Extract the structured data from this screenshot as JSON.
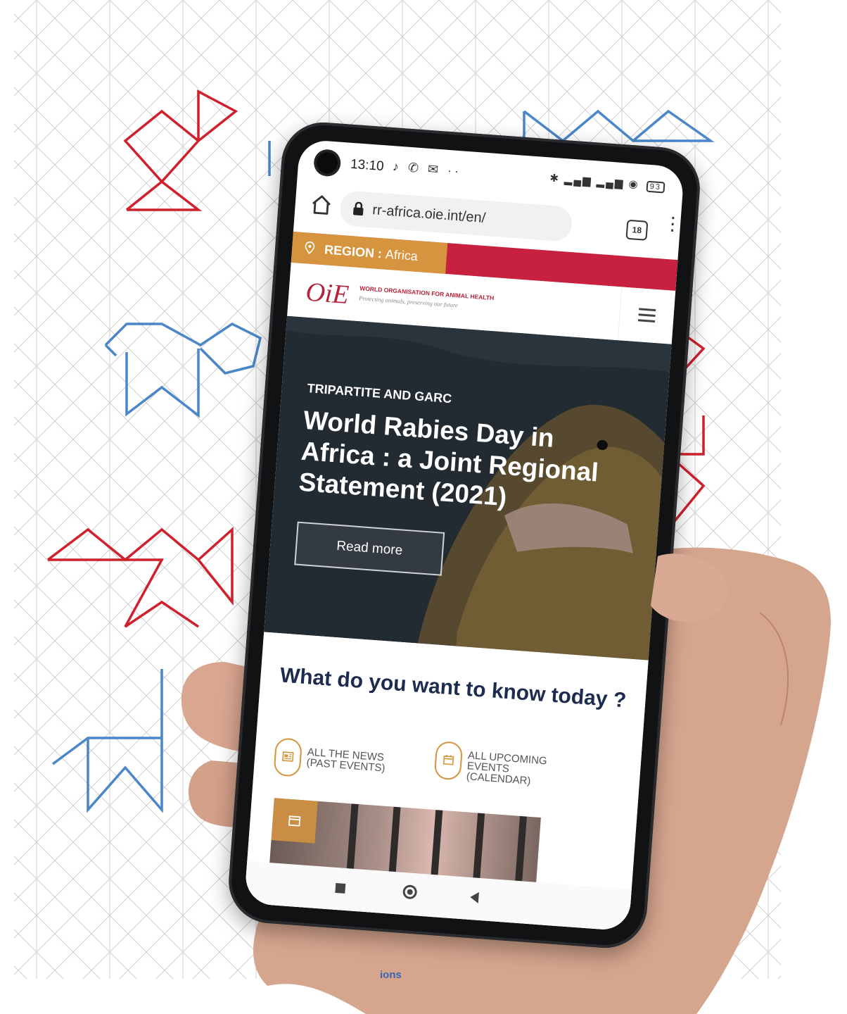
{
  "colors": {
    "blue_outline": "#4a86c8",
    "red_outline": "#d0202c",
    "oie_red": "#c8203f",
    "oie_orange": "#d7943e",
    "navy": "#1d2b4f"
  },
  "status_bar": {
    "time": "13:10",
    "left_icons": "♪ ✆ ✉ ··",
    "right_icons": "✱ ▂▄▆ ▂▄▆ ◉",
    "battery": "93"
  },
  "browser": {
    "url": "rr-africa.oie.int/en/",
    "tab_count": "18",
    "home_icon": "home-icon",
    "lock_icon": "lock-icon",
    "menu_icon": "kebab-menu-icon"
  },
  "region_bar": {
    "label": "REGION : ",
    "value": "Africa",
    "icon": "map-pin-icon"
  },
  "header": {
    "logo": "OiE",
    "org_name": "WORLD ORGANISATION FOR ANIMAL HEALTH",
    "tagline": "Protecting animals, preserving our future",
    "menu_icon": "hamburger-icon"
  },
  "hero": {
    "kicker": "TRIPARTITE AND GARC",
    "title": "World Rabies Day in Africa : a Joint Regional Statement (2021)",
    "button": "Read more"
  },
  "section": {
    "title": "What do you want to know today ?",
    "links": [
      {
        "label": "ALL THE NEWS (PAST EVENTS)",
        "icon": "newspaper-icon"
      },
      {
        "label": "ALL UPCOMING EVENTS (CALENDAR)",
        "icon": "calendar-icon"
      }
    ],
    "thumb_icon": "calendar-icon"
  },
  "nav": {
    "recents_icon": "square-icon",
    "home_icon": "circle-icon",
    "back_icon": "back-triangle-icon"
  },
  "bottom_fragment": "ions"
}
